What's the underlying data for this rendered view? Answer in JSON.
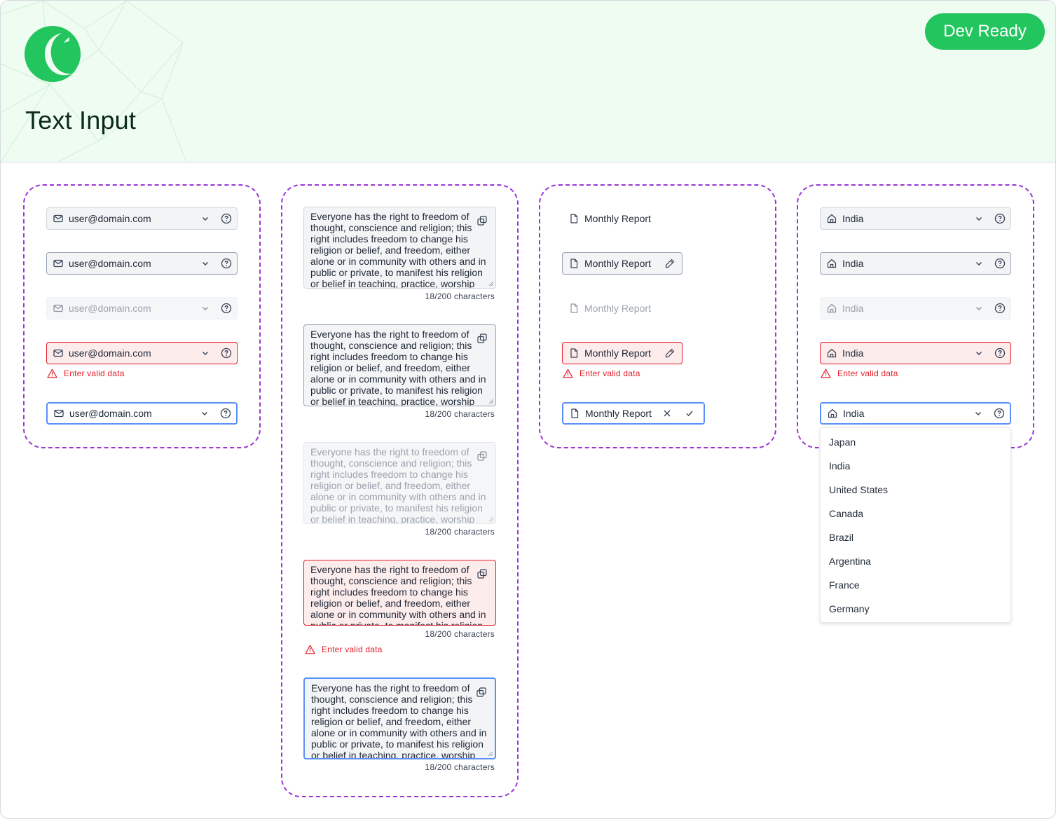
{
  "header": {
    "title": "Text Input",
    "status_badge": "Dev Ready",
    "brand_color": "#22c55e"
  },
  "icons": {
    "email": "mail-icon",
    "dropdown": "chevron-down-icon",
    "help": "question-circle-icon",
    "error": "warning-triangle-icon",
    "document": "file-icon",
    "edit": "pencil-icon",
    "clear": "close-icon",
    "confirm": "check-icon",
    "copy": "copy-icon",
    "location": "home-icon"
  },
  "email_inputs": {
    "value": "user@domain.com",
    "error_message": "Enter valid data"
  },
  "textareas": {
    "value": "Everyone has the right to freedom of thought, conscience and religion; this right includes freedom to change his religion or belief, and freedom, either alone or in community with others and in public or private, to manifest his religion or belief in teaching, practice, worship and observance.",
    "counter": "18/200 characters",
    "error_message": "Enter valid data"
  },
  "inline_inputs": {
    "value": "Monthly Report",
    "error_message": "Enter valid data"
  },
  "country_select": {
    "value": "India",
    "error_message": "Enter valid data",
    "options": [
      "Japan",
      "India",
      "United States",
      "Canada",
      "Brazil",
      "Argentina",
      "France",
      "Germany"
    ]
  },
  "colors": {
    "error": "#e11d2a",
    "focus": "#5b8ff9",
    "group_border": "#9b35d6"
  }
}
